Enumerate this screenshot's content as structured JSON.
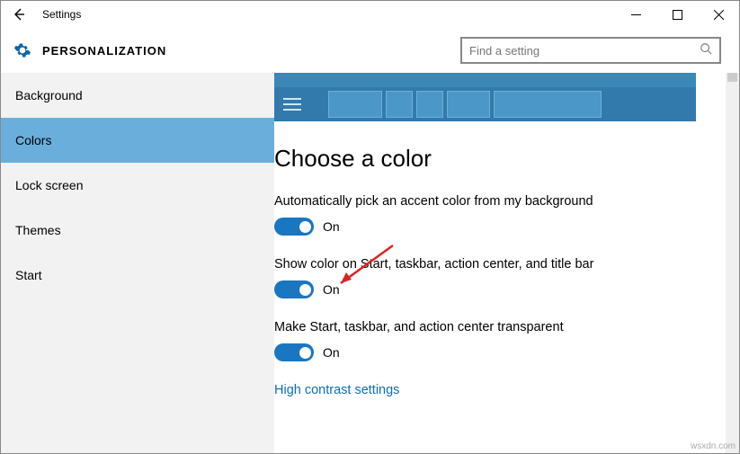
{
  "titlebar": {
    "title": "Settings"
  },
  "header": {
    "page_title": "PERSONALIZATION",
    "search_placeholder": "Find a setting"
  },
  "sidebar": {
    "items": [
      {
        "label": "Background"
      },
      {
        "label": "Colors"
      },
      {
        "label": "Lock screen"
      },
      {
        "label": "Themes"
      },
      {
        "label": "Start"
      }
    ],
    "active_index": 1
  },
  "main": {
    "section_title": "Choose a color",
    "options": [
      {
        "label": "Automatically pick an accent color from my background",
        "state": "On"
      },
      {
        "label": "Show color on Start, taskbar, action center, and title bar",
        "state": "On"
      },
      {
        "label": "Make Start, taskbar, and action center transparent",
        "state": "On"
      }
    ],
    "link": "High contrast settings"
  },
  "watermark": "wsxdn.com"
}
